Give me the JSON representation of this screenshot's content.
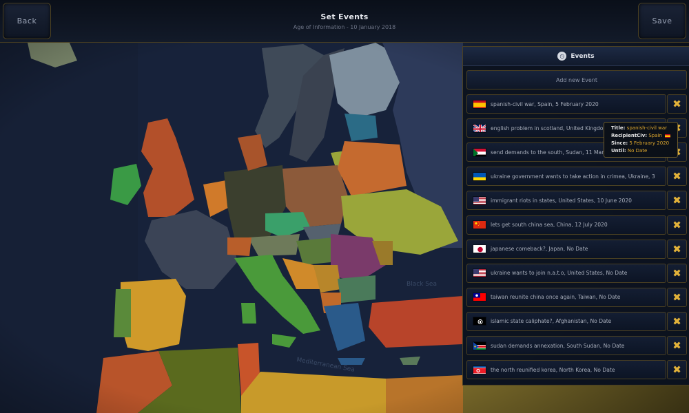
{
  "header": {
    "back_label": "Back",
    "save_label": "Save",
    "title": "Set Events",
    "subtitle": "Age of Information - 10 January 2018"
  },
  "panel": {
    "title": "Events",
    "icon": "clock-icon",
    "add_label": "Add new Event"
  },
  "events": [
    {
      "label": "spanish-civil war, Spain, 5 February 2020",
      "flag": "spain"
    },
    {
      "label": "english problem in scotland, United Kingdom, 1 June 2020",
      "flag": "uk"
    },
    {
      "label": "send demands to the south, Sudan, 11 March 2020",
      "flag": "sudan"
    },
    {
      "label": "ukraine government wants to take action in crimea, Ukraine, 3",
      "flag": "ukraine"
    },
    {
      "label": "immigrant riots in states, United States, 10 June 2020",
      "flag": "usa"
    },
    {
      "label": "lets get south china sea, China, 12 July 2020",
      "flag": "china"
    },
    {
      "label": "japanese comeback?, Japan, No Date",
      "flag": "japan"
    },
    {
      "label": "ukraine wants to join n.a.t.o, United States, No Date",
      "flag": "usa"
    },
    {
      "label": "taiwan reunite china once again, Taiwan, No Date",
      "flag": "taiwan"
    },
    {
      "label": "islamic state caliphate?, Afghanistan, No Date",
      "flag": "afghanistan"
    },
    {
      "label": "sudan demands annexation, South Sudan, No Date",
      "flag": "south-sudan"
    },
    {
      "label": "the north reunified korea, North Korea, No Date",
      "flag": "north-korea"
    }
  ],
  "delete_glyph": "✖",
  "tooltip": {
    "title_key": "Title:",
    "title_val": "spanish-civil war",
    "civ_key": "RecipientCiv:",
    "civ_val": "Spain",
    "since_key": "Since:",
    "since_val": "5 February 2020",
    "until_key": "Until:",
    "until_val": "No Date"
  },
  "map_labels": {
    "sea1": "Black Sea",
    "sea2": "Mediterranean Sea"
  },
  "colors": {
    "gold_border": "#4a4022",
    "delete_x": "#e2b23a",
    "tooltip_value": "#e0a92e",
    "sea": "#17223a"
  }
}
